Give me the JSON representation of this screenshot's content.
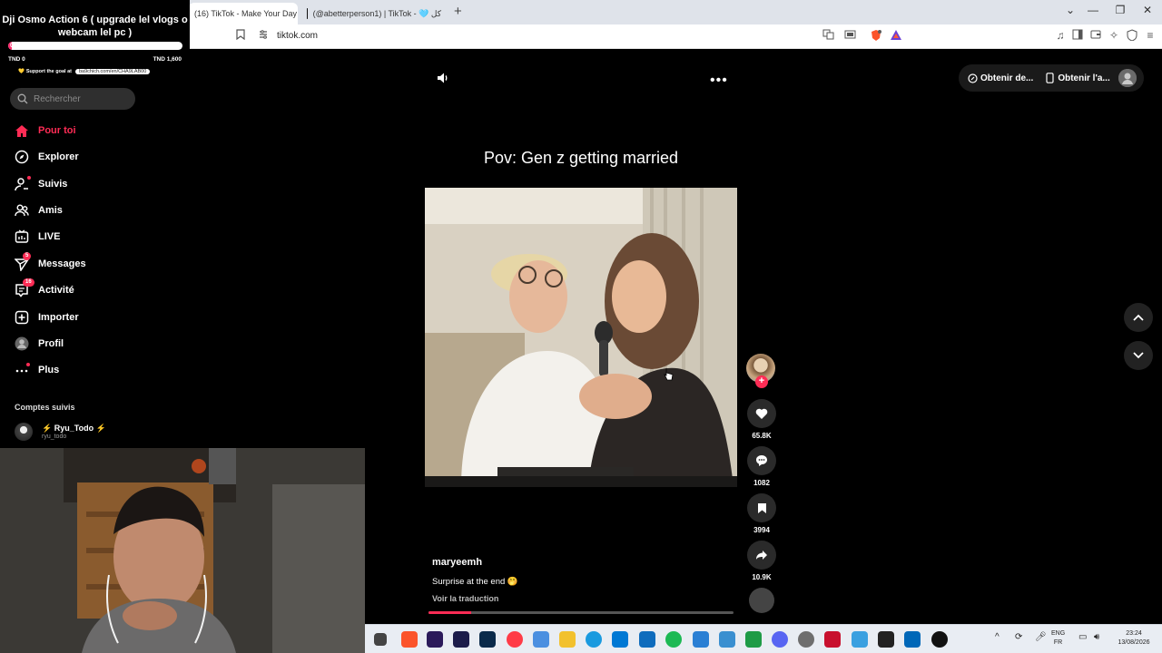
{
  "browser": {
    "tabs": [
      {
        "title": "(16) TikTok - Make Your Day",
        "active": true
      },
      {
        "title": "(@abetterperson1) | TikTok - 🩵 ﻛﻞ",
        "active": false
      }
    ],
    "url": "tiktok.com"
  },
  "goal": {
    "title": "Dji Osmo Action 6 ( upgrade lel vlogs o webcam lel pc )",
    "bar_label": "0%",
    "progress": 0.02,
    "min": "TND 0",
    "max": "TND 1,600",
    "support_text": "Support the goal at",
    "support_link": "ba9chich.com/en/CHA9LAB00",
    "accent": "#ff2a6d"
  },
  "sidebar": {
    "search_placeholder": "Rechercher",
    "nav": [
      {
        "label": "Pour toi",
        "icon": "home-icon",
        "active": true
      },
      {
        "label": "Explorer",
        "icon": "compass-icon"
      },
      {
        "label": "Suivis",
        "icon": "user-follow-icon"
      },
      {
        "label": "Amis",
        "icon": "friends-icon"
      },
      {
        "label": "LIVE",
        "icon": "live-icon"
      },
      {
        "label": "Messages",
        "icon": "send-icon",
        "badge": "5"
      },
      {
        "label": "Activité",
        "icon": "inbox-icon",
        "badge": "16"
      },
      {
        "label": "Importer",
        "icon": "upload-icon"
      },
      {
        "label": "Profil",
        "icon": "profile-avatar-icon"
      },
      {
        "label": "Plus",
        "icon": "more-icon"
      }
    ],
    "following_title": "Comptes suivis",
    "following": [
      {
        "name": "Ryu_Todo",
        "handle": "ryu_todo"
      }
    ]
  },
  "header": {
    "get_coins": "Obtenir de...",
    "get_app": "Obtenir l'a..."
  },
  "post": {
    "title": "Pov: Gen z getting married",
    "author": "maryeemh",
    "caption": "Surprise at the end 🤭",
    "translate": "Voir la traduction",
    "progress": 0.14,
    "likes": "65.8K",
    "comments": "1082",
    "saves": "3994",
    "shares": "10.9K"
  },
  "taskbar": {
    "lang_top": "ENG",
    "lang_bottom": "FR",
    "time": "23:24",
    "date": "13/08/2026"
  },
  "colors": {
    "tiktok_red": "#fe2c55",
    "bg": "#000000"
  }
}
